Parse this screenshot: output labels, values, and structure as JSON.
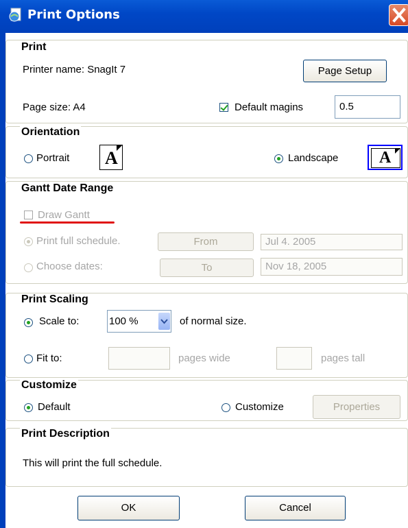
{
  "window": {
    "title": "Print Options"
  },
  "print": {
    "heading": "Print",
    "printer_label": "Printer name: SnagIt 7",
    "page_setup": "Page Setup",
    "page_size_label": "Page size: A4",
    "default_margins_label": "Default magins",
    "default_margins_checked": true,
    "margin_value": "0.5"
  },
  "orientation": {
    "heading": "Orientation",
    "portrait": "Portrait",
    "landscape": "Landscape",
    "selected": "landscape",
    "icon_letter": "A"
  },
  "gantt": {
    "heading": "Gantt Date Range",
    "draw_gantt": "Draw Gantt",
    "print_full": "Print full schedule.",
    "choose_dates": "Choose dates:",
    "from_label": "From",
    "to_label": "To",
    "from_date": "Jul 4. 2005",
    "to_date": "Nov 18, 2005"
  },
  "scaling": {
    "heading": "Print Scaling",
    "scale_to": "Scale to:",
    "scale_value": "100 %",
    "of_normal": "of normal size.",
    "fit_to": "Fit to:",
    "pages_wide": "pages wide",
    "pages_tall": "pages tall"
  },
  "customize": {
    "heading": "Customize",
    "default": "Default",
    "customize": "Customize",
    "properties": "Properties"
  },
  "description": {
    "heading": "Print Description",
    "text": "This will print the full schedule."
  },
  "buttons": {
    "ok": "OK",
    "cancel": "Cancel"
  },
  "colors": {
    "titlebar": "#0047c6",
    "selection_box": "#0000ff",
    "annotation": "#e01010"
  }
}
